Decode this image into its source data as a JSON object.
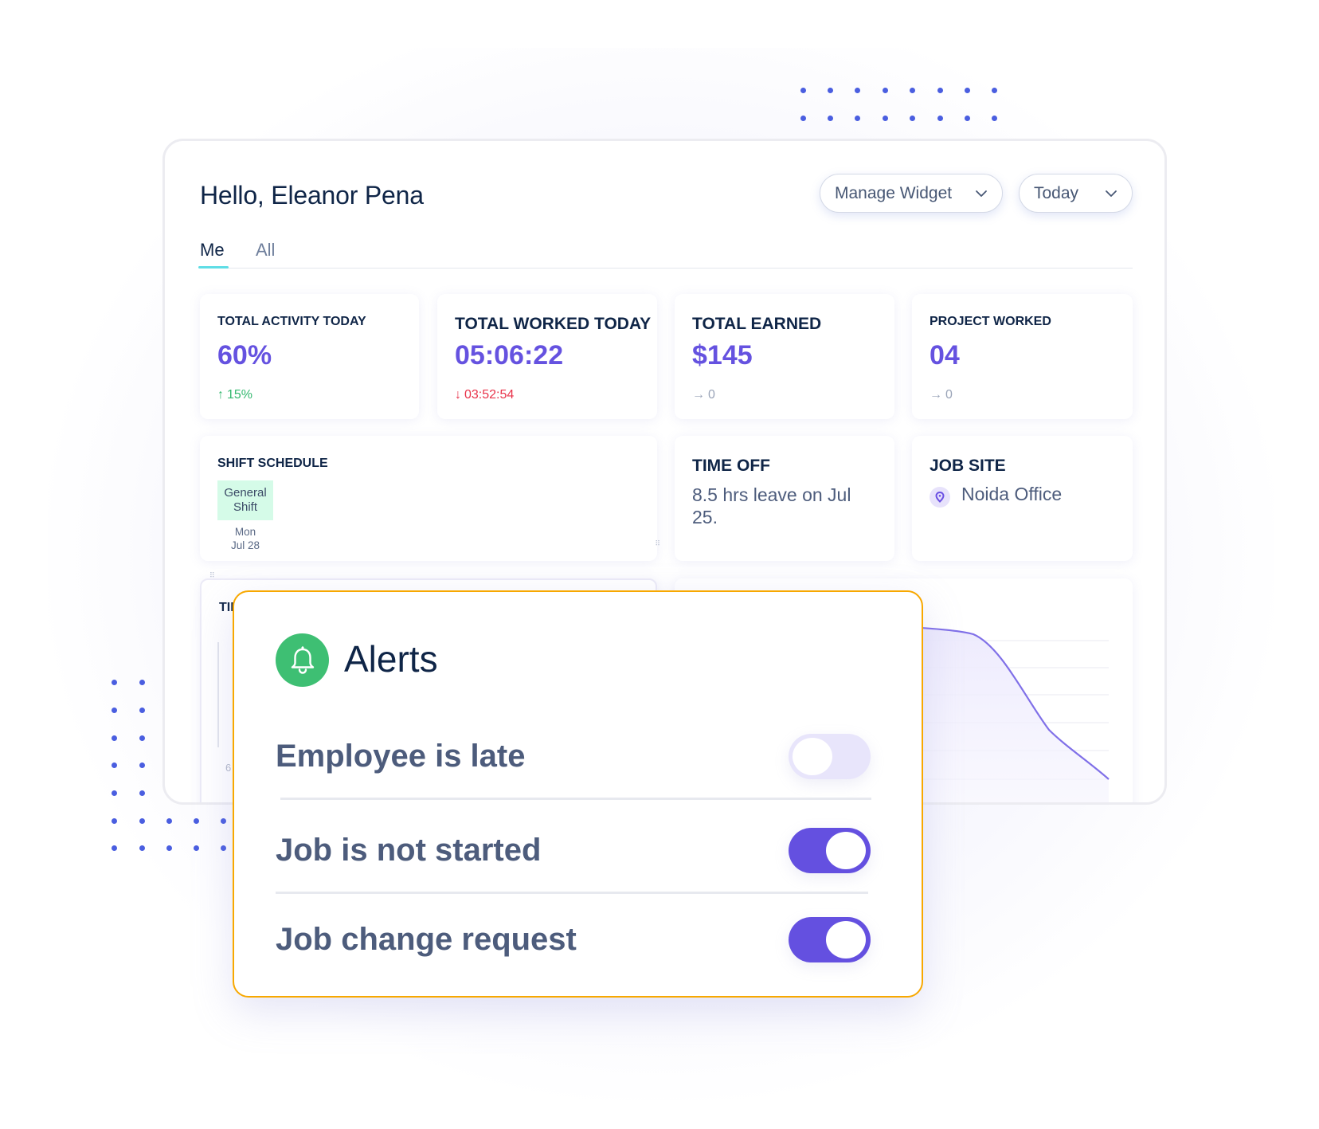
{
  "greeting": "Hello, Eleanor Pena",
  "header": {
    "manage_widget_label": "Manage Widget",
    "date_range_label": "Today"
  },
  "tabs": [
    {
      "label": "Me",
      "active": true
    },
    {
      "label": "All",
      "active": false
    }
  ],
  "widgets": {
    "total_activity": {
      "title": "TOTAL ACTIVITY TODAY",
      "value": "60%",
      "delta": "15%",
      "delta_direction": "up",
      "delta_icon": "↑"
    },
    "total_worked": {
      "title": "TOTAL WORKED TODAY",
      "value": "05:06:22",
      "delta": "03:52:54",
      "delta_direction": "down",
      "delta_icon": "↓"
    },
    "total_earned": {
      "title": "TOTAL EARNED",
      "value": "$145",
      "delta": "0",
      "delta_direction": "flat",
      "delta_icon": "→"
    },
    "project_worked": {
      "title": "PROJECT WORKED",
      "value": "04",
      "delta": "0",
      "delta_direction": "flat",
      "delta_icon": "→"
    },
    "shift_schedule": {
      "title": "SHIFT SCHEDULE",
      "shift_name": "General Shift",
      "day": "Mon",
      "date": "Jul 28"
    },
    "time_off": {
      "title": "TIME OFF",
      "text": "8.5 hrs leave on Jul 25."
    },
    "job_site": {
      "title": "JOB SITE",
      "location": "Noida Office",
      "icon": "location-pin-icon"
    },
    "timesheet": {
      "title_partial": "TIM",
      "axis_label": "6"
    }
  },
  "alerts": {
    "title": "Alerts",
    "icon": "bell-icon",
    "items": [
      {
        "label": "Employee is late",
        "enabled": false
      },
      {
        "label": "Job is not started",
        "enabled": true
      },
      {
        "label": "Job change request",
        "enabled": true
      }
    ]
  },
  "colors": {
    "accent": "#6552e0",
    "tab_underline": "#5fdde6",
    "alerts_border": "#f8a800",
    "bell_bg": "#3ebf73",
    "positive": "#34b86f",
    "negative": "#e8334a",
    "toggle_on": "#6450e0",
    "toggle_off": "#e8e5fb",
    "decor_dots": "#4a5ee0"
  }
}
